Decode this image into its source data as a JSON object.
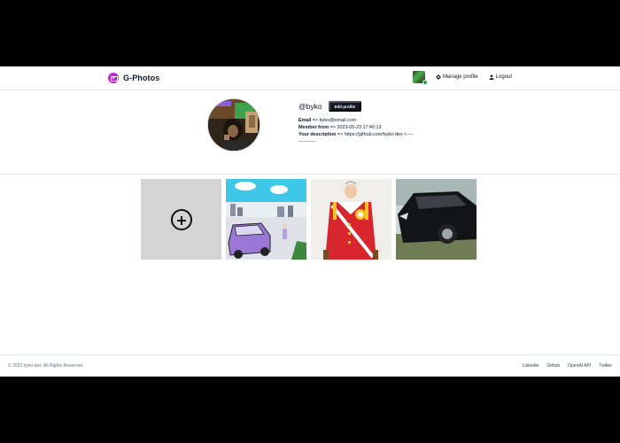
{
  "header": {
    "brand": "G-Photos",
    "manage_profile": "Manage profile",
    "logout": "Logout"
  },
  "profile": {
    "username": "@byko",
    "edit_button": "Edit profile",
    "email_label": "Email",
    "email_value": " => byko@email.com",
    "member_label": "Member from",
    "member_value": " => 2023-05-23 17:40:13",
    "description_label": "Your description",
    "description_value": " => https://github.com/byko-dev <---------------"
  },
  "gallery": {
    "items": [
      "upload",
      "anime-street-car",
      "king-portrait",
      "black-car"
    ]
  },
  "footer": {
    "copyright": "© 2023 byko-dev. All Rights Reserved.",
    "links": [
      "Linkedin",
      "Github",
      "OpenAI API",
      "Twitter"
    ]
  },
  "colors": {
    "brand": "#c026d3",
    "button_dark": "#111827",
    "online": "#16a34a",
    "upload_tile": "#d4d4d4"
  }
}
